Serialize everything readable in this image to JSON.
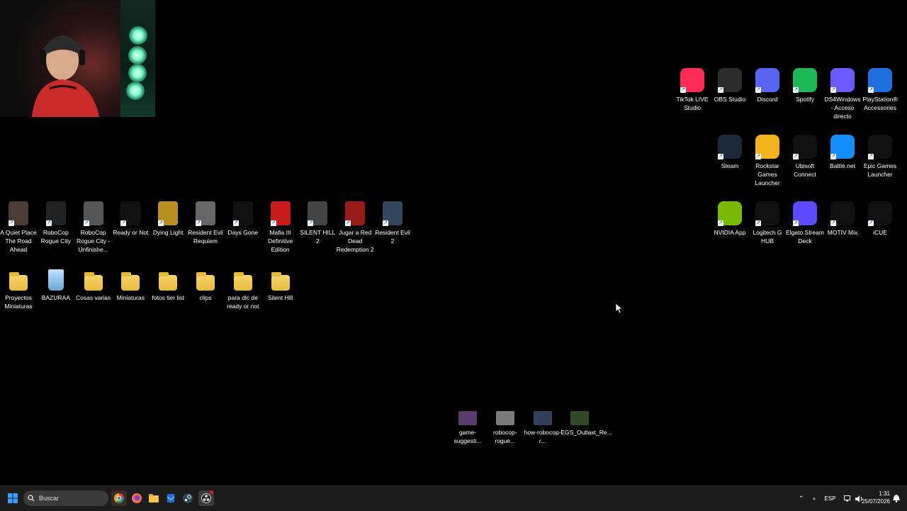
{
  "desktop": {
    "app_icons_right": [
      {
        "label": "TikTok LIVE Studio",
        "icon": "tiktok-live-icon",
        "color": "#ff2d55"
      },
      {
        "label": "OBS Studio",
        "icon": "obs-icon",
        "color": "#2b2b2b"
      },
      {
        "label": "Discord",
        "icon": "discord-icon",
        "color": "#5865f2"
      },
      {
        "label": "Spotify",
        "icon": "spotify-icon",
        "color": "#1db954"
      },
      {
        "label": "DS4Windows - Acceso directo",
        "icon": "ds4windows-icon",
        "color": "#6a5cff"
      },
      {
        "label": "PlayStation® Accessories",
        "icon": "playstation-icon",
        "color": "#1f6fe0"
      },
      {
        "label": "Steam",
        "icon": "steam-icon",
        "color": "#1b2838"
      },
      {
        "label": "Rockstar Games Launcher",
        "icon": "rockstar-icon",
        "color": "#f3b31c"
      },
      {
        "label": "Ubisoft Connect",
        "icon": "ubisoft-icon",
        "color": "#111"
      },
      {
        "label": "Battle.net",
        "icon": "battlenet-icon",
        "color": "#148eff"
      },
      {
        "label": "Epic Games Launcher",
        "icon": "epic-games-icon",
        "color": "#111"
      },
      {
        "label": "NVIDIA App",
        "icon": "nvidia-icon",
        "color": "#76b900"
      },
      {
        "label": "Logitech G HUB",
        "icon": "logitech-icon",
        "color": "#111"
      },
      {
        "label": "Elgato Stream Deck",
        "icon": "streamdeck-icon",
        "color": "#5b4cff"
      },
      {
        "label": "MOTIV Mix",
        "icon": "motiv-icon",
        "color": "#111"
      },
      {
        "label": "iCUE",
        "icon": "icue-icon",
        "color": "#111"
      }
    ],
    "game_icons": [
      {
        "label": "A Quiet Place The Road Ahead",
        "color": "#4a3b33"
      },
      {
        "label": "RoboCop Rogue City",
        "color": "#222"
      },
      {
        "label": "RoboCop Rogue City - Unfinishe...",
        "color": "#555"
      },
      {
        "label": "Ready or Not",
        "color": "#111"
      },
      {
        "label": "Dying Light",
        "color": "#b8901f"
      },
      {
        "label": "Resident Evil Requiem",
        "color": "#666"
      },
      {
        "label": "Days Gone",
        "color": "#111"
      },
      {
        "label": "Mafia III Definitive Edition",
        "color": "#c51b1b"
      },
      {
        "label": "SILENT HILL 2",
        "color": "#444"
      },
      {
        "label": "Jugar a Red Dead Redemption 2",
        "color": "#9a1a1a"
      },
      {
        "label": "Resident Evil 2",
        "color": "#30475e"
      }
    ],
    "folder_icons": [
      {
        "label": "Proyectos Miniaturas",
        "type": "folder"
      },
      {
        "label": "BAZURAA",
        "type": "recycle-bin"
      },
      {
        "label": "Cosas varias",
        "type": "folder"
      },
      {
        "label": "Miniaturas",
        "type": "folder"
      },
      {
        "label": "fotos tier list",
        "type": "folder"
      },
      {
        "label": "clips",
        "type": "folder"
      },
      {
        "label": "para dlc de ready or not",
        "type": "folder"
      },
      {
        "label": "Silent Hill",
        "type": "folder"
      }
    ],
    "file_thumbs": [
      {
        "label": "game-suggesti...",
        "color": "#5a3b6b"
      },
      {
        "label": "robocop-rogue...",
        "color": "#7a7a7a"
      },
      {
        "label": "how-robocop-r...",
        "color": "#30405a"
      },
      {
        "label": "EGS_Outlast_Re...",
        "color": "#2f4a24"
      }
    ]
  },
  "taskbar": {
    "search_placeholder": "Buscar",
    "tray_lang": "ESP",
    "time": "1:31",
    "date": "25/07/2026"
  }
}
